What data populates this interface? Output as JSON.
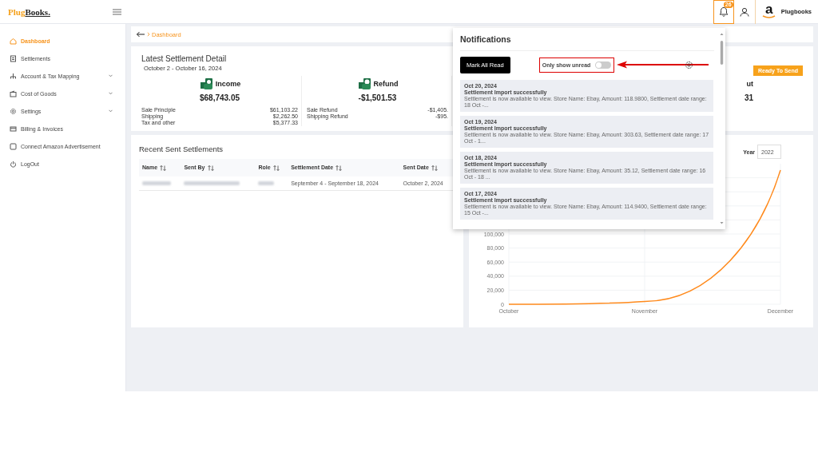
{
  "header": {
    "logo": {
      "part1": "Plug",
      "part2": "Books."
    },
    "notification_count": "26",
    "amazon_letter": "a",
    "account_name": "Plugbooks"
  },
  "sidebar": {
    "items": [
      {
        "label": "Dashboard",
        "selected": true,
        "expandable": false
      },
      {
        "label": "Settlements",
        "selected": false,
        "expandable": false
      },
      {
        "label": "Account & Tax Mapping",
        "selected": false,
        "expandable": true
      },
      {
        "label": "Cost of Goods",
        "selected": false,
        "expandable": true
      },
      {
        "label": "Settings",
        "selected": false,
        "expandable": true
      },
      {
        "label": "Billing & Invoices",
        "selected": false,
        "expandable": false
      },
      {
        "label": "Connect Amazon Advertisement",
        "selected": false,
        "expandable": false
      },
      {
        "label": "LogOut",
        "selected": false,
        "expandable": false
      }
    ]
  },
  "breadcrumb": {
    "current": "Dashboard"
  },
  "settlement": {
    "title": "Latest Settlement Detail",
    "date_range": "October 2 - October 16, 2024",
    "status_button": "Ready To Send",
    "columns": [
      {
        "kind": "income",
        "title": "Income",
        "amount": "$68,743.05",
        "lines": [
          {
            "label": "Sale Principle",
            "value": "$61,103.22"
          },
          {
            "label": "Shipping",
            "value": "$2,262.50"
          },
          {
            "label": "Tax and other",
            "value": "$5,377.33"
          }
        ]
      },
      {
        "kind": "refund",
        "title": "Refund",
        "amount": "-$1,501.53",
        "lines": [
          {
            "label": "Sale Refund",
            "value": "-$1,405."
          },
          {
            "label": "Shipping Refund",
            "value": "-$95."
          }
        ]
      },
      {
        "kind": "payout",
        "title": "ut",
        "amount": "31"
      }
    ]
  },
  "recent": {
    "title": "Recent Sent Settlements",
    "columns": [
      "Name",
      "Sent By",
      "Role",
      "Settlement Date",
      "Sent Date"
    ],
    "rows": [
      {
        "cells": [
          {
            "kind": "blurred"
          },
          {
            "kind": "blurred"
          },
          {
            "kind": "blurred"
          },
          {
            "kind": "text",
            "text": "September 4 - September 18, 2024"
          },
          {
            "kind": "text",
            "text": "October 2, 2024"
          }
        ]
      }
    ]
  },
  "chart_panel": {
    "year_label": "Year",
    "year_value": "2022",
    "chart_data": {
      "type": "line",
      "categories": [
        "October",
        "November",
        "December"
      ],
      "series": [
        {
          "color": "#ff8a1c",
          "values": [
            0,
            4000,
            191000
          ]
        }
      ],
      "ylim": [
        0,
        200000
      ],
      "grid": true,
      "yticks": [
        {
          "value": 0,
          "label": "0"
        },
        {
          "value": 20000,
          "label": "20,000"
        },
        {
          "value": 40000,
          "label": "40,000"
        },
        {
          "value": 60000,
          "label": "60,000"
        },
        {
          "value": 80000,
          "label": "80,000"
        },
        {
          "value": 100000,
          "label": "100,000"
        }
      ]
    }
  },
  "notifications": {
    "title": "Notifications",
    "mark_all_button": "Mark All Read",
    "toggle": {
      "label": "Only show unread",
      "on": false
    },
    "items": [
      {
        "date": "Oct 20, 2024",
        "title": "Settlement Import successfully",
        "body": "Settlement is now available to view. Store Name: Ebay, Amount: 118.9800, Settlement date range: 18 Oct -..."
      },
      {
        "date": "Oct 19, 2024",
        "title": "Settlement Import successfully",
        "body": "Settlement is now available to view. Store Name: Ebay, Amount: 303.63, Settlement date range: 17 Oct - 1..."
      },
      {
        "date": "Oct 18, 2024",
        "title": "Settlement Import successfully",
        "body": "Settlement is now available to view. Store Name: Ebay, Amount: 35.12, Settlement date range: 16 Oct - 18 ..."
      },
      {
        "date": "Oct 17, 2024",
        "title": "Settlement Import successfully",
        "body": "Settlement is now available to view. Store Name: Ebay, Amount: 114.9400, Settlement date range: 15 Oct -..."
      }
    ]
  }
}
